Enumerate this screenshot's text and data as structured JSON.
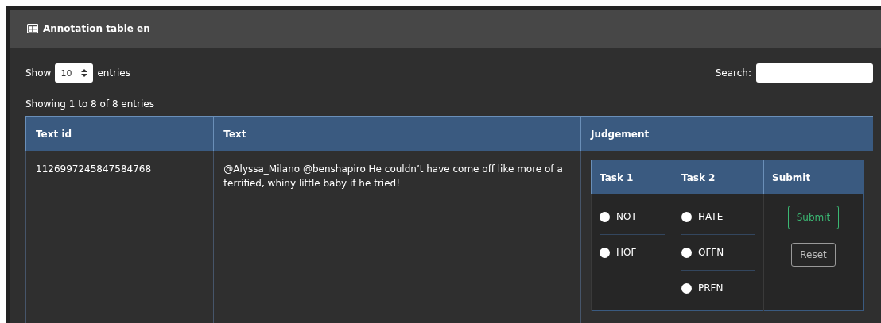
{
  "panel": {
    "title": "Annotation table en"
  },
  "length": {
    "before": "Show",
    "value": "10",
    "after": "entries"
  },
  "search": {
    "label": "Search:"
  },
  "info": "Showing 1 to 8 of 8 entries",
  "table": {
    "columns": [
      "Text id",
      "Text",
      "Judgement"
    ],
    "rows": [
      {
        "text_id": "1126997245847584768",
        "text": "@Alyssa_Milano @benshapiro He couldn’t have come off like more of a terrified, whiny little baby if he tried!",
        "judgement": {
          "columns": [
            "Task 1",
            "Task 2",
            "Submit"
          ],
          "task_1": [
            {
              "label": "NOT",
              "selected": false
            },
            {
              "label": "HOF",
              "selected": false
            }
          ],
          "task_2": [
            {
              "label": "HATE",
              "selected": false
            },
            {
              "label": "OFFN",
              "selected": false
            },
            {
              "label": "PRFN",
              "selected": false
            }
          ],
          "buttons": [
            {
              "label": "Submit",
              "kind": "submit"
            },
            {
              "label": "Reset",
              "kind": "reset"
            }
          ]
        }
      }
    ]
  }
}
